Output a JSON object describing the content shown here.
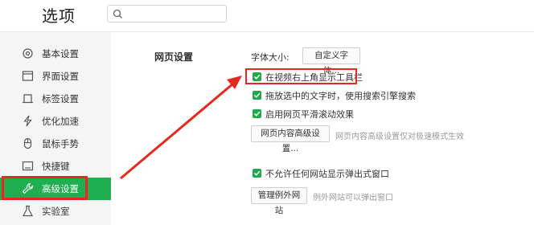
{
  "header": {
    "title": "选项",
    "search_placeholder": ""
  },
  "sidebar": {
    "items": [
      {
        "label": "基本设置",
        "icon": "gear-icon"
      },
      {
        "label": "界面设置",
        "icon": "window-icon"
      },
      {
        "label": "标签设置",
        "icon": "tab-icon"
      },
      {
        "label": "优化加速",
        "icon": "lightning-icon"
      },
      {
        "label": "鼠标手势",
        "icon": "mouse-icon"
      },
      {
        "label": "快捷键",
        "icon": "keyboard-icon"
      },
      {
        "label": "高级设置",
        "icon": "wrench-icon",
        "active": true
      },
      {
        "label": "实验室",
        "icon": "flask-icon"
      }
    ]
  },
  "main": {
    "section_title": "网页设置",
    "font_size_label": "字体大小:",
    "custom_font_button": "自定义字体...",
    "checkboxes": [
      {
        "label": "在视频右上角显示工具栏",
        "checked": true
      },
      {
        "label": "拖放选中的文字时，使用搜索引擎搜索",
        "checked": true
      },
      {
        "label": "启用网页平滑滚动效果",
        "checked": true
      },
      {
        "label": "不允许任何网站显示弹出式窗口",
        "checked": true
      }
    ],
    "advanced_button": "网页内容高级设置...",
    "advanced_hint": "网页内容高级设置仅对极速模式生效",
    "exceptions_button": "管理例外网站",
    "exceptions_hint": "例外网站可以弹出窗口"
  },
  "colors": {
    "accent": "#1fae50",
    "highlight": "#e42a20"
  }
}
